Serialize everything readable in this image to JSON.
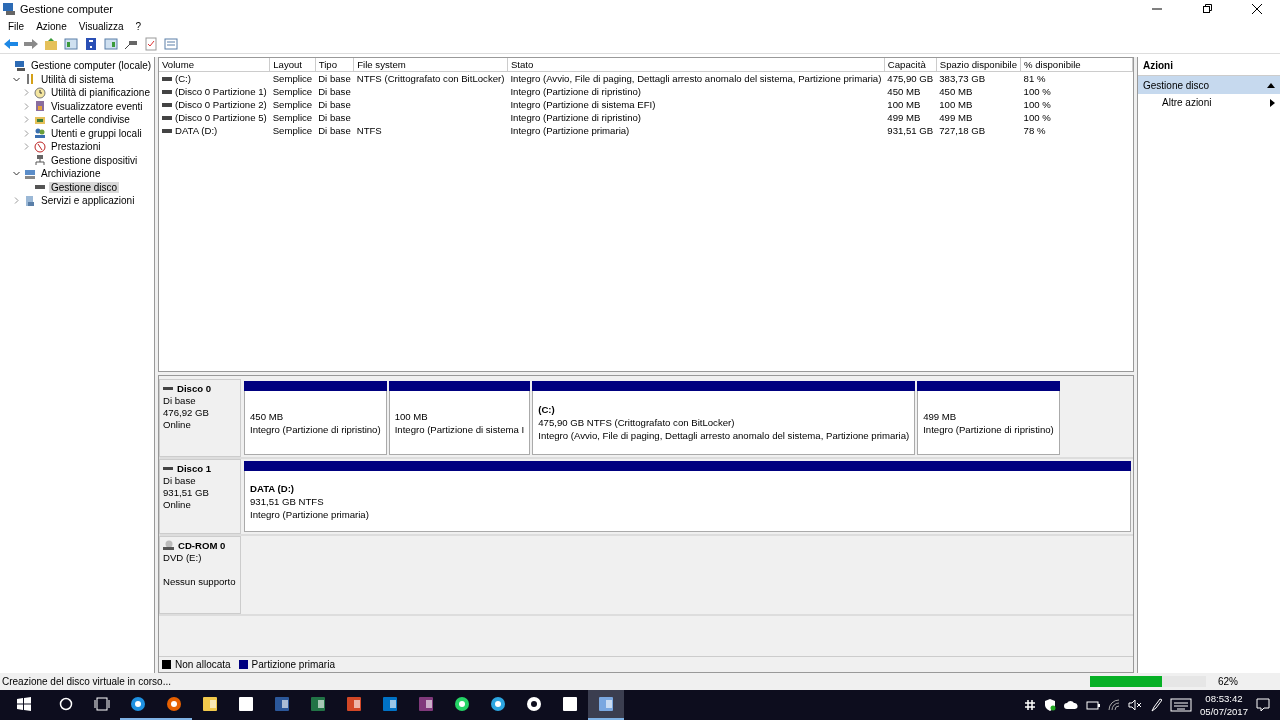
{
  "window": {
    "title": "Gestione computer"
  },
  "menu": [
    "File",
    "Azione",
    "Visualizza",
    "?"
  ],
  "tree": [
    {
      "label": "Gestione computer (locale)",
      "kind": "computer",
      "selected": false,
      "children": [
        {
          "label": "Utilità di sistema",
          "kind": "tools",
          "selected": false,
          "expanded": true,
          "children": [
            {
              "label": "Utilità di pianificazione",
              "kind": "clock",
              "selected": false,
              "expanded": false
            },
            {
              "label": "Visualizzatore eventi",
              "kind": "log",
              "selected": false,
              "expanded": false
            },
            {
              "label": "Cartelle condivise",
              "kind": "folder",
              "selected": false,
              "expanded": false
            },
            {
              "label": "Utenti e gruppi locali",
              "kind": "users",
              "selected": false,
              "expanded": false
            },
            {
              "label": "Prestazioni",
              "kind": "gauge",
              "selected": false,
              "expanded": false
            },
            {
              "label": "Gestione dispositivi",
              "kind": "device",
              "selected": false
            }
          ]
        },
        {
          "label": "Archiviazione",
          "kind": "storage",
          "selected": false,
          "expanded": true,
          "children": [
            {
              "label": "Gestione disco",
              "kind": "disk",
              "selected": true
            }
          ]
        },
        {
          "label": "Servizi e applicazioni",
          "kind": "services",
          "selected": false,
          "expanded": false
        }
      ]
    }
  ],
  "table": {
    "columns": [
      "Volume",
      "Layout",
      "Tipo",
      "File system",
      "Stato",
      "Capacità",
      "Spazio disponibile",
      "% disponibile"
    ],
    "rows": [
      [
        "(C:)",
        "Semplice",
        "Di base",
        "NTFS (Crittografato con BitLocker)",
        "Integro (Avvio, File di paging, Dettagli arresto anomalo del sistema, Partizione primaria)",
        "475,90 GB",
        "383,73 GB",
        "81 %"
      ],
      [
        "(Disco 0 Partizione 1)",
        "Semplice",
        "Di base",
        "",
        "Integro (Partizione di ripristino)",
        "450 MB",
        "450 MB",
        "100 %"
      ],
      [
        "(Disco 0 Partizione 2)",
        "Semplice",
        "Di base",
        "",
        "Integro (Partizione di sistema EFI)",
        "100 MB",
        "100 MB",
        "100 %"
      ],
      [
        "(Disco 0 Partizione 5)",
        "Semplice",
        "Di base",
        "",
        "Integro (Partizione di ripristino)",
        "499 MB",
        "499 MB",
        "100 %"
      ],
      [
        "DATA (D:)",
        "Semplice",
        "Di base",
        "NTFS",
        "Integro (Partizione primaria)",
        "931,51 GB",
        "727,18 GB",
        "78 %"
      ]
    ]
  },
  "disks": [
    {
      "kind": "disk",
      "name": "Disco 0",
      "type": "Di base",
      "size": "476,92 GB",
      "status": "Online",
      "fill": false,
      "partitions": [
        {
          "size": "450 MB",
          "status": "Integro (Partizione di ripristino)",
          "color": "#00007f"
        },
        {
          "size": "100 MB",
          "status": "Integro (Partizione di sistema I",
          "color": "#00007f"
        },
        {
          "label": "(C:)",
          "size": "475,90 GB NTFS (Crittografato con BitLocker)",
          "status": "Integro (Avvio, File di paging, Dettagli arresto anomalo del sistema, Partizione primaria)",
          "color": "#00007f"
        },
        {
          "size": "499 MB",
          "status": "Integro (Partizione di ripristino)",
          "color": "#00007f"
        }
      ]
    },
    {
      "kind": "disk",
      "name": "Disco 1",
      "type": "Di base",
      "size": "931,51 GB",
      "status": "Online",
      "fill": true,
      "partitions": [
        {
          "label": "DATA  (D:)",
          "size": "931,51 GB NTFS",
          "status": "Integro (Partizione primaria)",
          "color": "#00007f"
        }
      ]
    },
    {
      "kind": "cdrom",
      "name": "CD-ROM 0",
      "type": "DVD (E:)",
      "status": "Nessun supporto"
    }
  ],
  "legend": [
    {
      "label": "Non allocata",
      "color": "#000000"
    },
    {
      "label": "Partizione primaria",
      "color": "#00007f"
    }
  ],
  "actions": {
    "title": "Azioni",
    "section": "Gestione disco",
    "expanded": true,
    "items": [
      "Altre azioni"
    ]
  },
  "status_bar": {
    "text": "Creazione del disco virtuale in corso...",
    "level": 0.62,
    "reading": "62%"
  },
  "taskbar": {
    "apps": [
      {
        "kind": "edge",
        "running": true,
        "selected": false
      },
      {
        "kind": "firefox",
        "running": true,
        "selected": false
      },
      {
        "kind": "explorer",
        "running": false,
        "selected": false
      },
      {
        "kind": "store",
        "running": false,
        "selected": false
      },
      {
        "kind": "word",
        "running": false,
        "selected": false
      },
      {
        "kind": "excel",
        "running": false,
        "selected": false
      },
      {
        "kind": "powerpoint",
        "running": false,
        "selected": false
      },
      {
        "kind": "outlook",
        "running": false,
        "selected": false
      },
      {
        "kind": "onenote",
        "running": false,
        "selected": false
      },
      {
        "kind": "whatsapp",
        "running": false,
        "selected": false
      },
      {
        "kind": "telegram",
        "running": false,
        "selected": false
      },
      {
        "kind": "slack",
        "running": false,
        "selected": false
      },
      {
        "kind": "notion",
        "running": false,
        "selected": false
      },
      {
        "kind": "compmgmt",
        "running": true,
        "selected": true
      }
    ],
    "time": "08:53:42",
    "date": "05/07/2017"
  }
}
